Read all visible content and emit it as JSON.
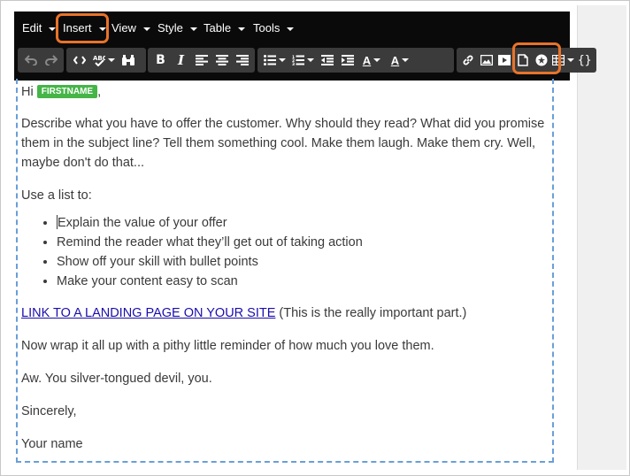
{
  "menubar": {
    "items": [
      {
        "label": "Edit"
      },
      {
        "label": "Insert"
      },
      {
        "label": "View"
      },
      {
        "label": "Style"
      },
      {
        "label": "Table"
      },
      {
        "label": "Tools"
      }
    ]
  },
  "toolbar": {
    "font_color_label": "A",
    "bg_color_label": "A",
    "source_label": "{}"
  },
  "content": {
    "greeting": "Hi",
    "merge_tag": "FIRSTNAME",
    "greeting_comma": ",",
    "paragraph1": "Describe what you have to offer the customer. Why should they read? What did you promise them in the subject line? Tell them something cool. Make them laugh. Make them cry. Well, maybe don't do that...",
    "list_intro": "Use a list to:",
    "list_items": [
      "Explain the value of your offer",
      "Remind the reader what they’ll get out of taking action",
      "Show off your skill with bullet points",
      "Make your content easy to scan"
    ],
    "link_text": "LINK TO A LANDING PAGE ON YOUR SITE",
    "link_suffix": " (This is the really important part.)",
    "paragraph_wrap": "Now wrap it all up with a pithy little reminder of how much you love them.",
    "paragraph_aw": "Aw. You silver-tongued devil, you.",
    "signoff": "Sincerely,",
    "signature": "Your name"
  },
  "colors": {
    "highlight": "#e8732a",
    "merge_tag_bg": "#45b547",
    "toolbar_bg": "#0a0a0a",
    "dashed_border": "#6a9fd8"
  }
}
